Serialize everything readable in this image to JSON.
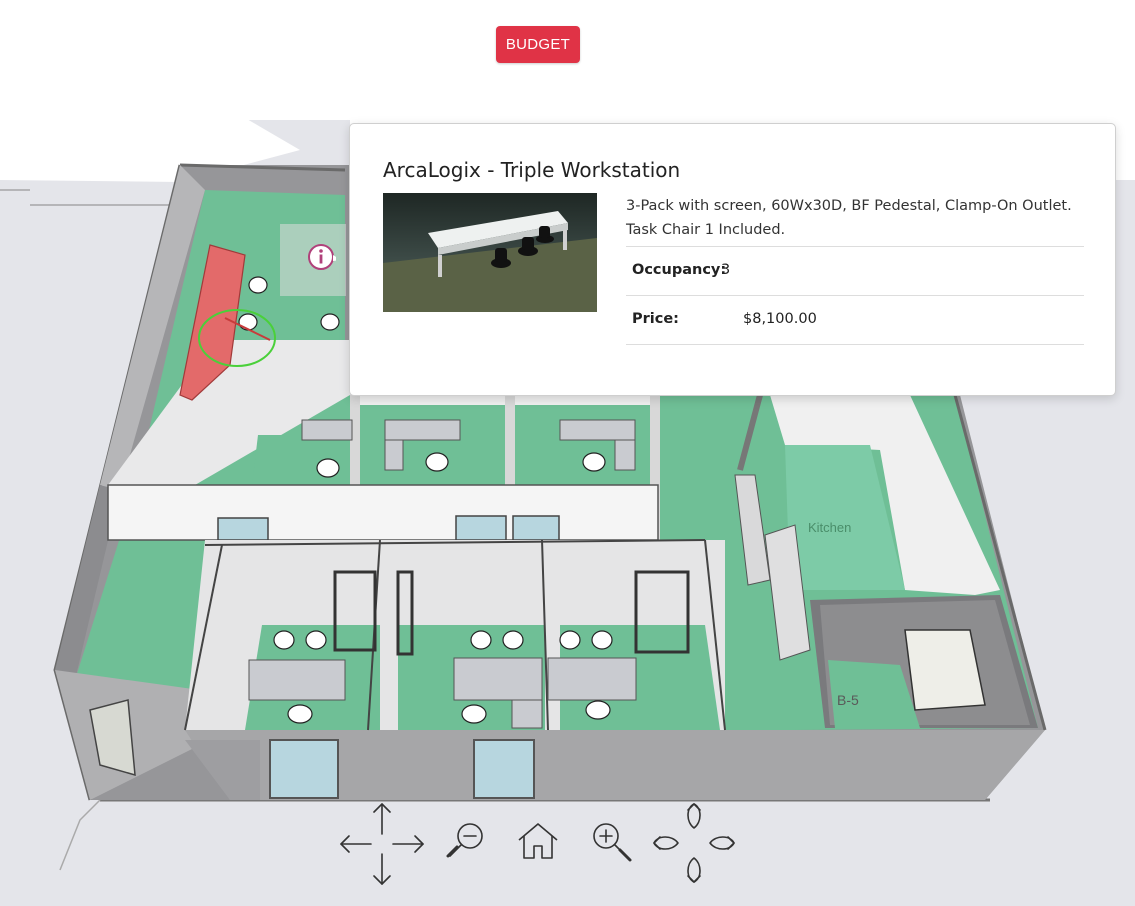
{
  "budget_button": {
    "label": "BUDGET",
    "color": "#e03346"
  },
  "popup": {
    "title": "ArcaLogix - Triple Workstation",
    "description": "3-Pack with screen, 60Wx30D, BF Pedestal, Clamp-On Outlet. Task Chair 1 Included.",
    "occupancy_label": "Occupancy:",
    "occupancy_value": "3",
    "price_label": "Price:",
    "price_value": "$8,100.00"
  },
  "floorplan": {
    "room_labels": {
      "kitchen": "Kitchen",
      "b5": "B-5"
    },
    "floor_color": "#6fc39a",
    "wall_color": "#a9a9a9",
    "selected_furniture_color": "#e36a6a"
  },
  "controls": [
    "pan-arrows-icon",
    "zoom-out-icon",
    "home-icon",
    "zoom-in-icon",
    "rotate-icon"
  ]
}
